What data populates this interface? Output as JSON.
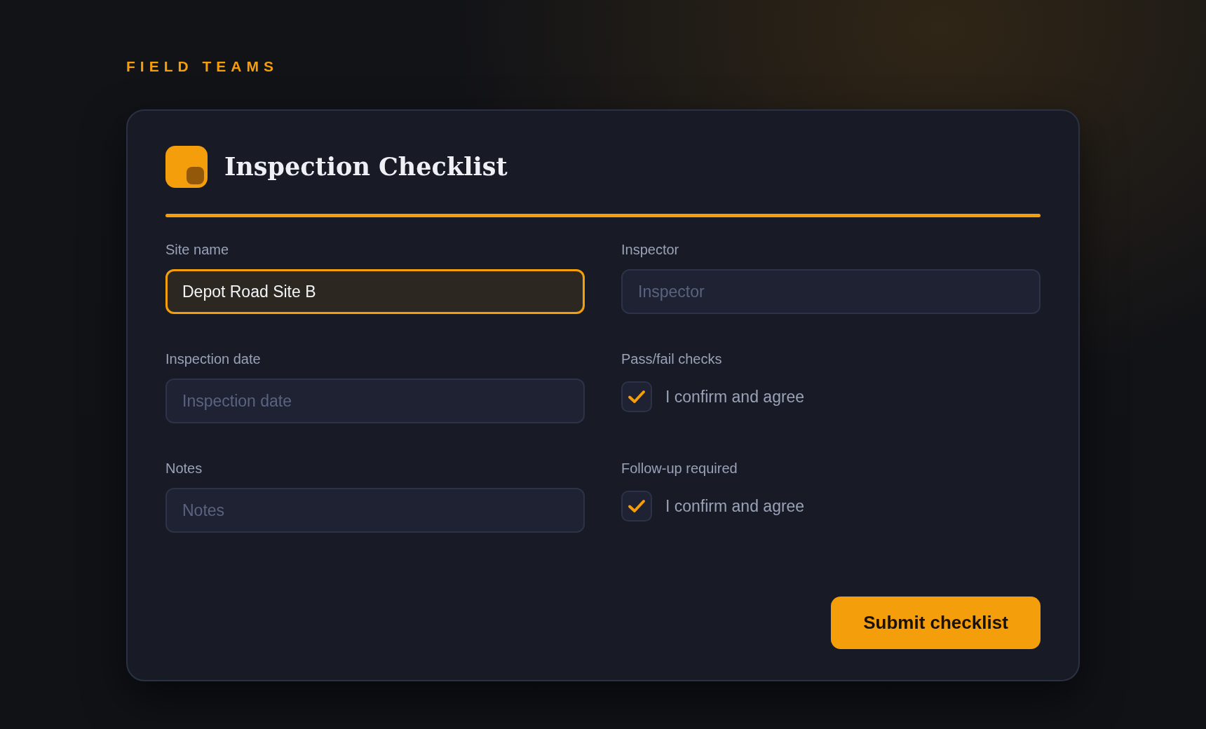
{
  "eyebrow": "FIELD TEAMS",
  "card": {
    "title": "Inspection Checklist",
    "fields": [
      {
        "kind": "text",
        "label": "Site name",
        "value": "Depot Road Site B",
        "focused": true
      },
      {
        "kind": "text",
        "label": "Inspector",
        "placeholder": "Inspector",
        "focused": false
      },
      {
        "kind": "text",
        "label": "Inspection date",
        "placeholder": "Inspection date",
        "focused": false
      },
      {
        "kind": "checkbox",
        "label": "Pass/fail checks",
        "option": "I confirm and agree",
        "checked": true
      },
      {
        "kind": "text",
        "label": "Notes",
        "placeholder": "Notes",
        "focused": false
      },
      {
        "kind": "checkbox",
        "label": "Follow-up required",
        "option": "I confirm and agree",
        "checked": true
      }
    ],
    "submit": "Submit checklist"
  }
}
